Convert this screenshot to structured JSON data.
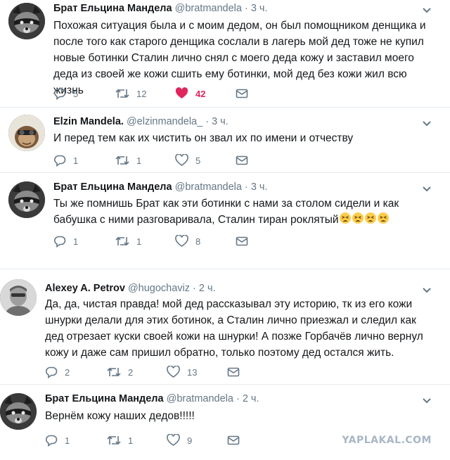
{
  "tweets": [
    {
      "name": "Брат Ельцина Мандела",
      "handle": "@bratmandela",
      "dot": "·",
      "time": "3 ч.",
      "text": "Похожая ситуация была и с моим дедом, он был помощником денщика и после того как старого денщика сослали в лагерь мой дед тоже не купил новые ботинки Сталин лично снял с моего деда кожу и заставил моего деда из своей же кожи сшить ему ботинки, мой дед без кожи жил всю жизнь",
      "replies": "5",
      "retweets": "12",
      "likes": "42",
      "liked": true,
      "avatar": "raccoon-avatar"
    },
    {
      "name": "Elzin Mandela.",
      "handle": "@elzinmandela_",
      "dot": "·",
      "time": "3 ч.",
      "text": "И перед тем как их чистить он звал их по имени и отчеству",
      "replies": "1",
      "retweets": "1",
      "likes": "5",
      "liked": false,
      "avatar": "monkey-avatar"
    },
    {
      "name": "Брат Ельцина Мандела",
      "handle": "@bratmandela",
      "dot": "·",
      "time": "3 ч.",
      "text": "Ты же помнишь Брат как эти ботинки с нами за столом сидели и как бабушка с ними разговаривала, Сталин тиран роклятый",
      "emoji_count": 4,
      "replies": "1",
      "retweets": "1",
      "likes": "8",
      "liked": false,
      "avatar": "raccoon-avatar"
    },
    {
      "name": "Alexey A. Petrov",
      "handle": "@hugochaviz",
      "dot": "·",
      "time": "2 ч.",
      "text": "Да, да, чистая правда! мой дед рассказывал эту историю, тк из его кожи шнурки делали для этих ботинок, а Сталин лично приезжал и следил как дед отрезает куски своей кожи на шнурки! А позже Горбачёв лично вернул кожу и даже сам пришил обратно, только поэтому дед остался жить.",
      "replies": "2",
      "retweets": "2",
      "likes": "13",
      "liked": false,
      "avatar": "bw-portrait-avatar"
    },
    {
      "name": "Брат Ельцина Мандела",
      "handle": "@bratmandela",
      "dot": "·",
      "time": "2 ч.",
      "text": "Вернём кожу наших дедов!!!!!",
      "replies": "1",
      "retweets": "1",
      "likes": "9",
      "liked": false,
      "avatar": "raccoon-avatar"
    }
  ],
  "watermark": "YAPLAKAL.COM",
  "colors": {
    "text": "#14171a",
    "secondary": "#657786",
    "like_active": "#e0245e",
    "separator": "#e6ecf0"
  }
}
